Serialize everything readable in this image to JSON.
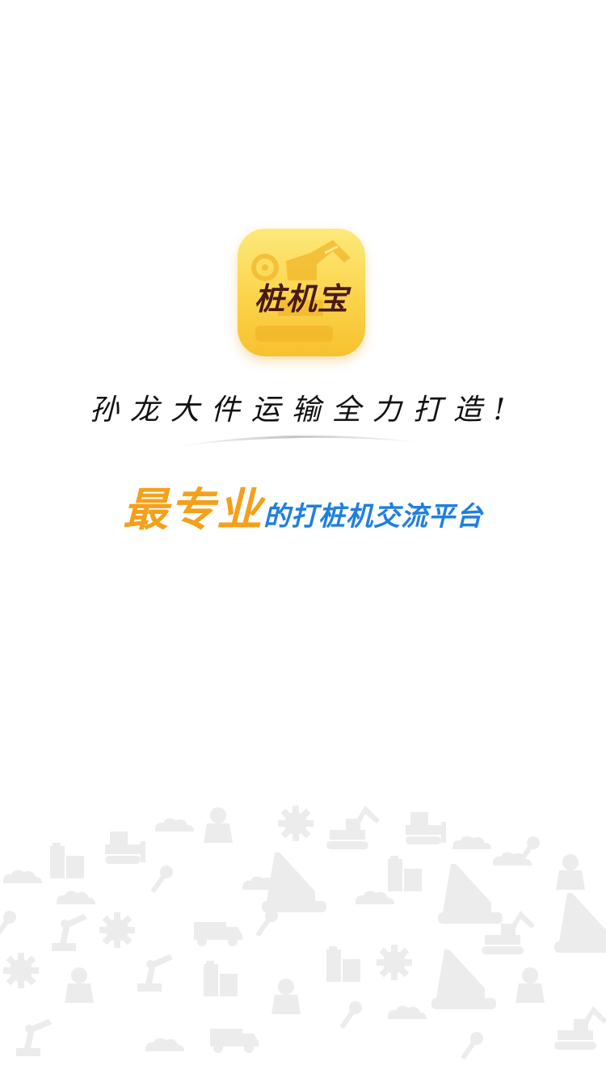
{
  "app": {
    "name": "桩机宝",
    "icon": "excavator-logo-icon"
  },
  "tagline": "孙龙大件运输全力打造!",
  "slogan": {
    "highlight": "最专业",
    "rest": "的打桩机交流平台"
  },
  "colors": {
    "highlight": "#f5a01a",
    "rest": "#1f7fe0",
    "icon_yellow": "#fbd34a",
    "name_brown": "#4a1a10",
    "decor_gray": "#e9e9e9"
  },
  "decor": {
    "icons": [
      "cloud-icon",
      "building-icon",
      "gear-icon",
      "crane-icon",
      "excavator-icon",
      "worker-icon",
      "bulldozer-icon",
      "truck-icon",
      "robot-arm-icon",
      "wrench-icon"
    ]
  }
}
